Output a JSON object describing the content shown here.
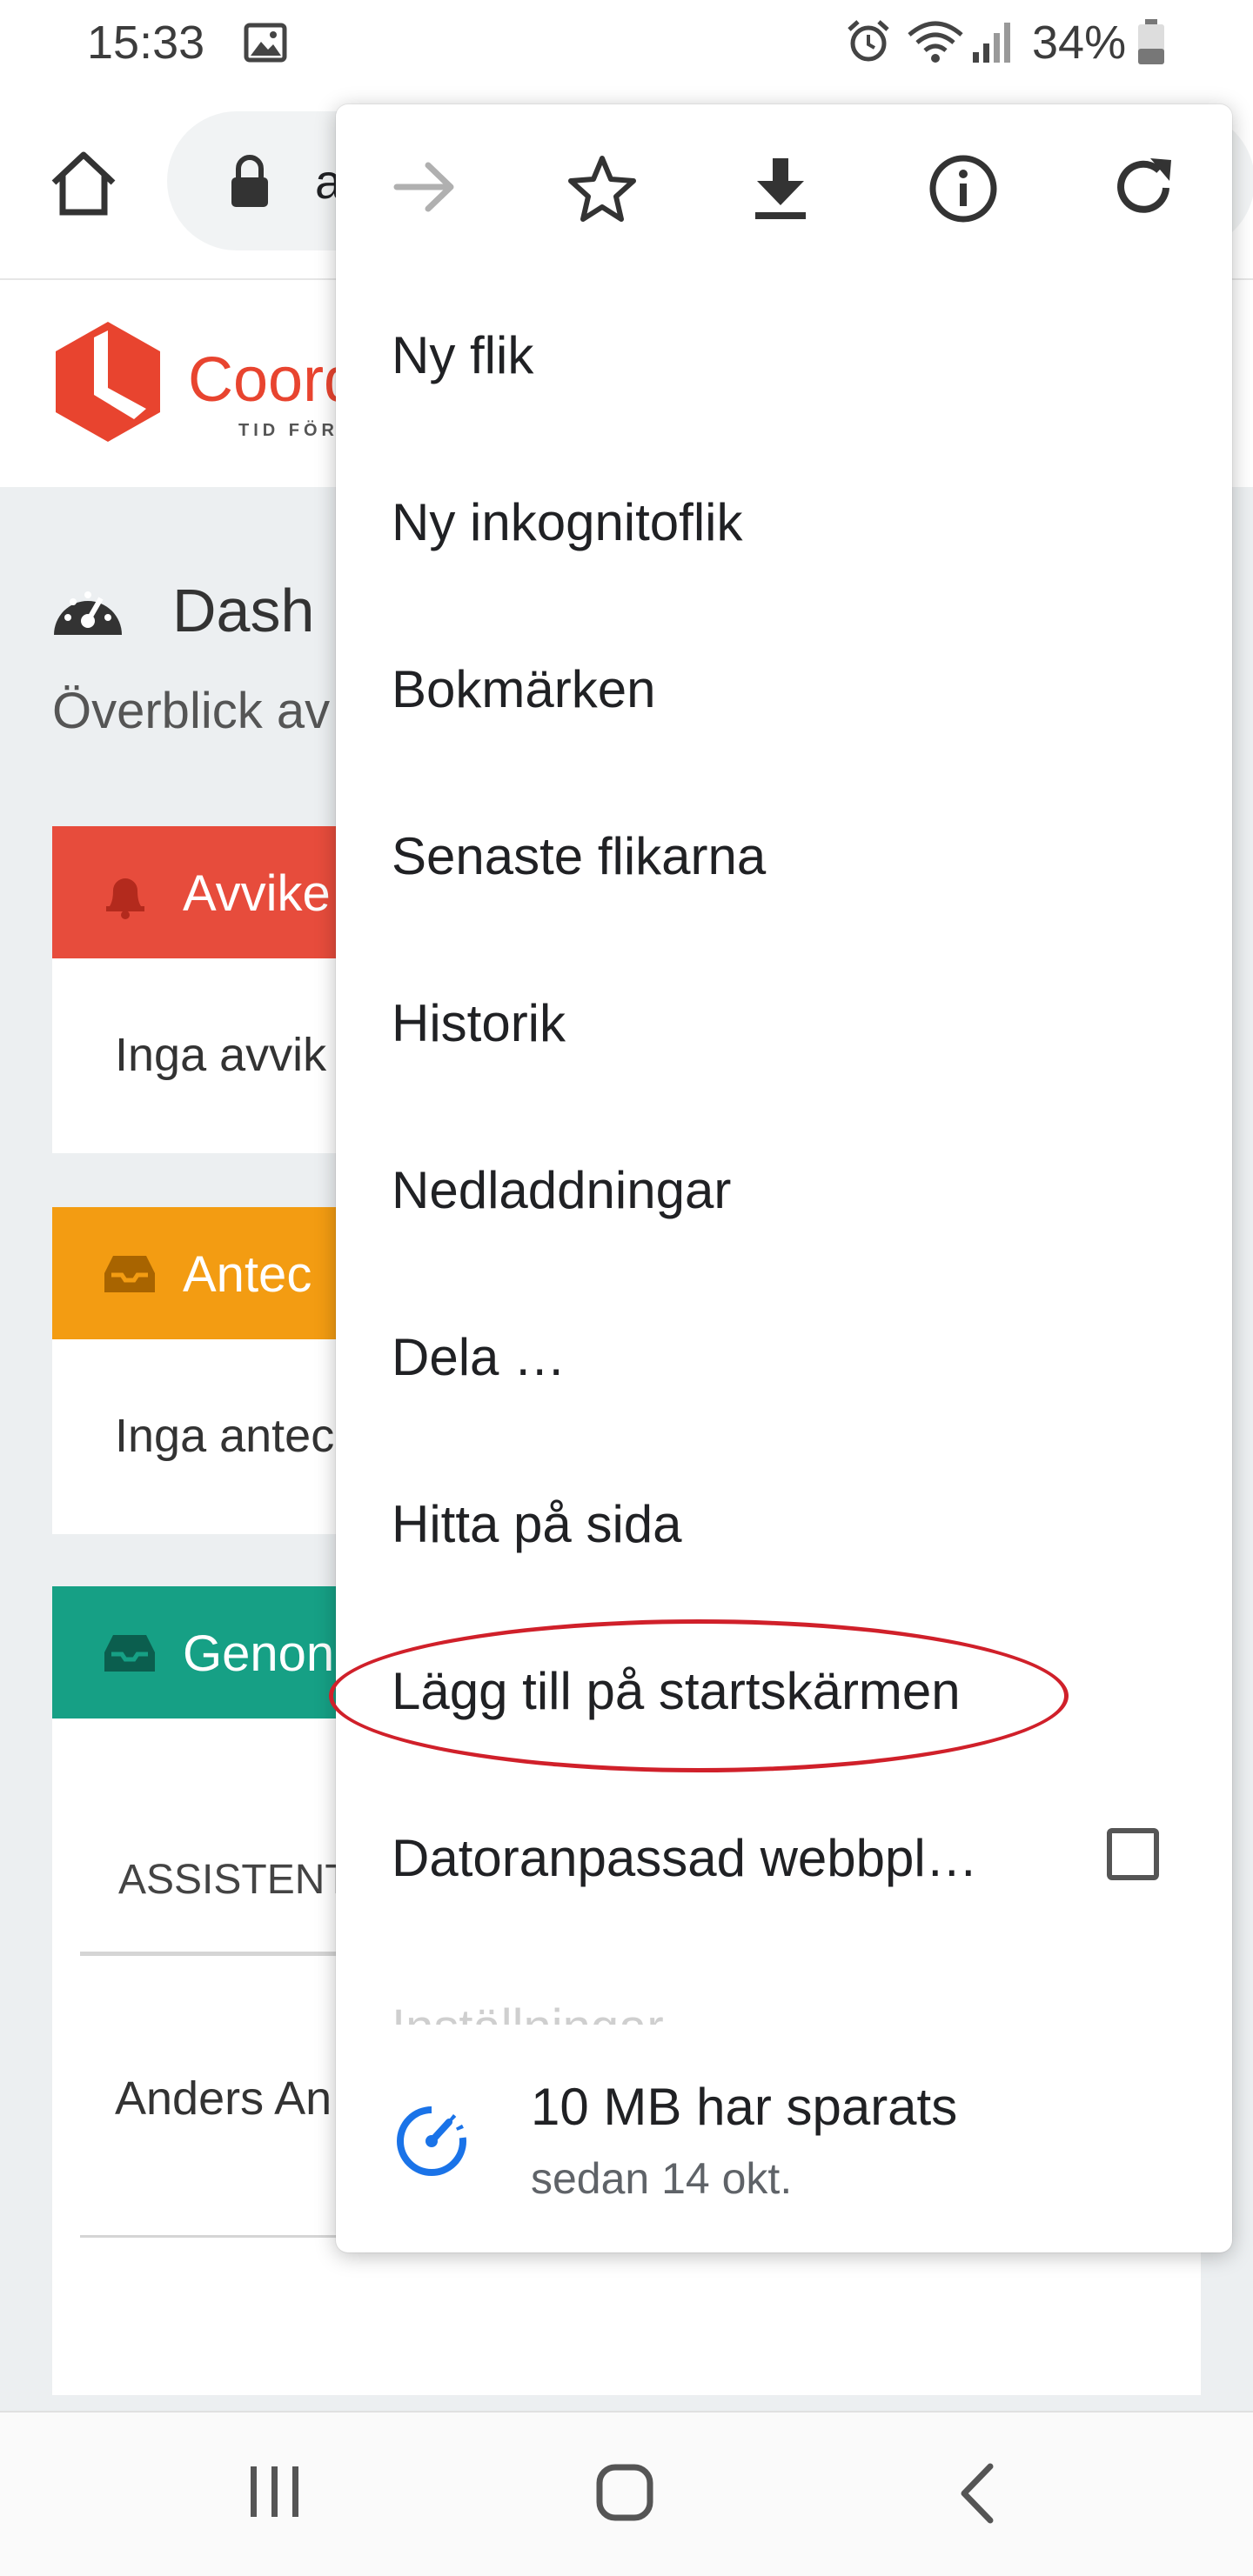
{
  "status": {
    "time": "15:33",
    "battery": "34%"
  },
  "browser": {
    "url_partial": "a"
  },
  "page": {
    "brand": "Coord",
    "brand_sub": "TID FÖR",
    "dashboard_title": "Dash",
    "subtitle": "Överblick av",
    "cards": [
      {
        "title": "Avvike",
        "body": "Inga avvik",
        "color": "#e74c3c"
      },
      {
        "title": "Antec",
        "body": "Inga antec",
        "color": "#f39c12"
      },
      {
        "title": "Genon",
        "body": "",
        "color": "#16a085"
      }
    ],
    "table_header": "ASSISTENT",
    "table_row": "Anders An"
  },
  "menu": {
    "items": [
      "Ny flik",
      "Ny inkognitoflik",
      "Bokmärken",
      "Senaste flikarna",
      "Historik",
      "Nedladdningar",
      "Dela …",
      "Hitta på sida",
      "Lägg till på startskärmen",
      "Datoranpassad webbpl…",
      "Inställningar"
    ],
    "desktop_site_checked": false,
    "data_saved": "10 MB har sparats",
    "data_saved_since": "sedan 14 okt."
  },
  "annotation": {
    "color": "#d0202a"
  }
}
